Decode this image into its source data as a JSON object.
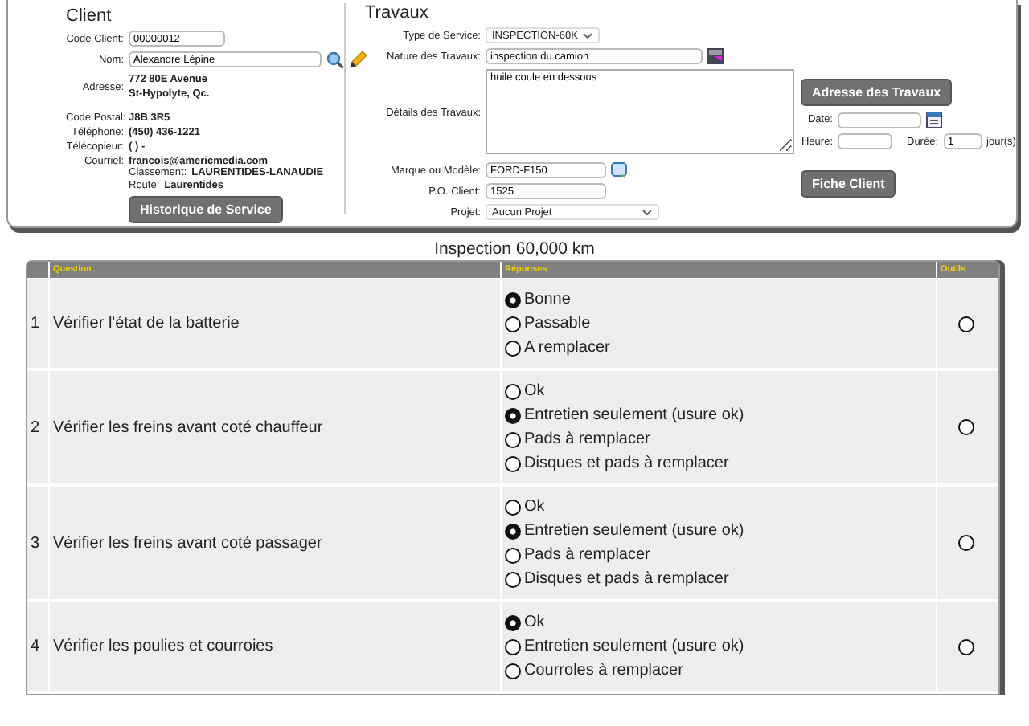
{
  "client": {
    "title": "Client",
    "code": {
      "label": "Code Client:",
      "value": "00000012"
    },
    "name": {
      "label": "Nom:",
      "value": "Alexandre Lépine"
    },
    "address": {
      "label": "Adresse:",
      "lines": [
        "772 80E Avenue",
        "St-Hypolyte, Qc."
      ]
    },
    "details": [
      {
        "label": "Code Postal:",
        "value": "J8B 3R5"
      },
      {
        "label": "Téléphone:",
        "value": "(450) 436-1221"
      },
      {
        "label": "Télécopieur:",
        "value": "( ) -"
      },
      {
        "label": "Courriel:",
        "value": "francois@americmedia.com"
      }
    ],
    "extra": [
      {
        "label": "Classement:",
        "value": "LAURENTIDES-LANAUDIE"
      },
      {
        "label": "Route:",
        "value": "Laurentides"
      }
    ],
    "history_button": "Historique de Service"
  },
  "travaux": {
    "title": "Travaux",
    "service_type": {
      "label": "Type de Service:",
      "value": "INSPECTION-60K"
    },
    "nature": {
      "label": "Nature des Travaux:",
      "value": "inspection du camion"
    },
    "details": {
      "label": "Détails des Travaux:",
      "value": "huile coule en dessous"
    },
    "model": {
      "label": "Marque ou Modèle:",
      "value": "FORD-F150"
    },
    "po": {
      "label": "P.O. Client:",
      "value": "1525"
    },
    "project": {
      "label": "Projet:",
      "value": "Aucun Projet"
    },
    "address_button": "Adresse des Travaux",
    "date": {
      "label": "Date:"
    },
    "time": {
      "label": "Heure:"
    },
    "duration": {
      "label": "Durée:",
      "value": "1",
      "unit": "jour(s)"
    },
    "fiche_button": "Fiche Client"
  },
  "inspection": {
    "title": "Inspection 60,000 km",
    "columns": [
      "Question",
      "Réponses",
      "Outils"
    ],
    "rows": [
      {
        "number": "1",
        "question": "Vérifier l'état de la batterie",
        "answers": [
          {
            "label": "Bonne",
            "selected": true
          },
          {
            "label": "Passable",
            "selected": false
          },
          {
            "label": "A remplacer",
            "selected": false
          }
        ],
        "tool_selected": false
      },
      {
        "number": "2",
        "question": "Vérifier les freins avant coté chauffeur",
        "answers": [
          {
            "label": "Ok",
            "selected": false
          },
          {
            "label": "Entretien seulement (usure ok)",
            "selected": true
          },
          {
            "label": "Pads à remplacer",
            "selected": false
          },
          {
            "label": "Disques et pads à remplacer",
            "selected": false
          }
        ],
        "tool_selected": false
      },
      {
        "number": "3",
        "question": "Vérifier les freins avant coté passager",
        "answers": [
          {
            "label": "Ok",
            "selected": false
          },
          {
            "label": "Entretien seulement (usure ok)",
            "selected": true
          },
          {
            "label": "Pads à remplacer",
            "selected": false
          },
          {
            "label": "Disques et pads à remplacer",
            "selected": false
          }
        ],
        "tool_selected": false
      },
      {
        "number": "4",
        "question": "Vérifier les poulies et courroies",
        "answers": [
          {
            "label": "Ok",
            "selected": true
          },
          {
            "label": "Entretien seulement (usure ok)",
            "selected": false
          },
          {
            "label": "Courroles à remplacer",
            "selected": false
          }
        ],
        "tool_selected": false
      }
    ]
  }
}
